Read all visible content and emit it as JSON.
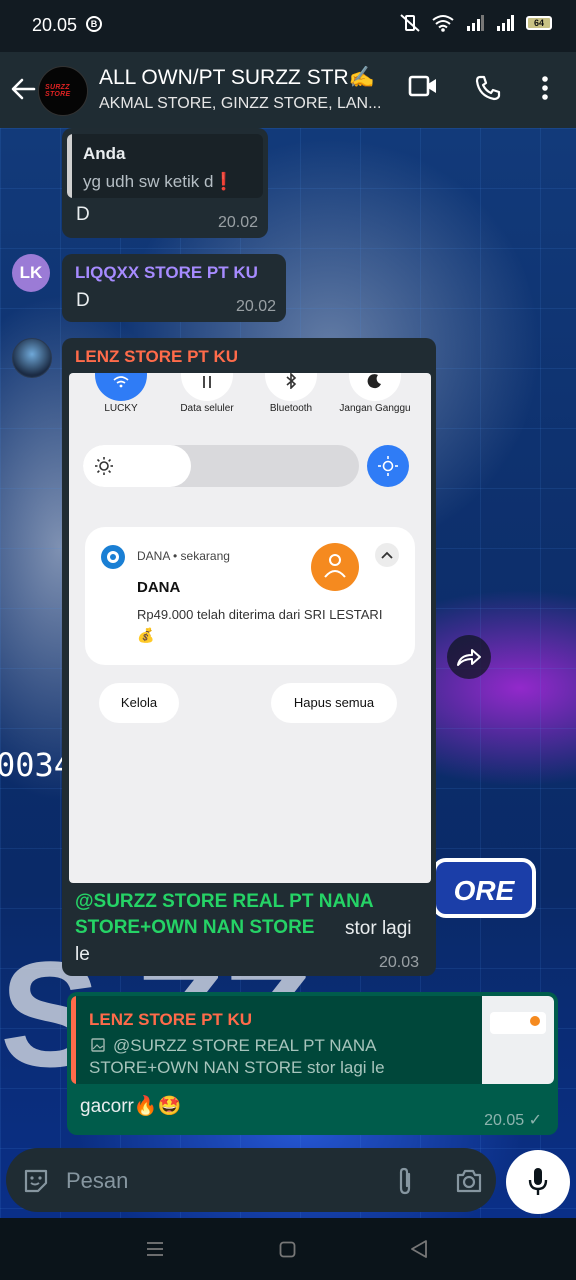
{
  "status_bar": {
    "time": "20.05",
    "battery": "64"
  },
  "header": {
    "title": "ALL OWN/PT SURZZ STR✍️",
    "subtitle": "AKMAL STORE, GINZZ STORE, LAN...",
    "avatar_text": "SURZZ STORE"
  },
  "wallpaper": {
    "watermark_number": "0034",
    "watermark_store": "ORE",
    "watermark_big": "S  ZZ"
  },
  "messages": [
    {
      "quote_sender": "Anda",
      "quote_text": "yg udh sw ketik d❗",
      "text": "D",
      "time": "20.02"
    },
    {
      "avatar_initials": "LK",
      "sender": "LIQQXX STORE PT KU",
      "text": "D",
      "time": "20.02"
    },
    {
      "sender": "LENZ STORE PT KU",
      "screenshot": {
        "tiles": [
          "LUCKY",
          "Data seluler",
          "Bluetooth",
          "Jangan Ganggu"
        ],
        "notif_app": "DANA • sekarang",
        "notif_title": "DANA",
        "notif_body": "Rp49.000 telah diterima dari SRI LESTARI",
        "notif_emoji": "💰",
        "btn_manage": "Kelola",
        "btn_clear": "Hapus semua"
      },
      "mention_line1": "@SURZZ STORE REAL PT NANA",
      "mention_line2": "STORE+OWN NAN STORE",
      "text_after_mention": "stor lagi",
      "text_line3": "le",
      "time": "20.03"
    },
    {
      "quote_sender": "LENZ STORE PT KU",
      "quote_line1": "@SURZZ STORE REAL PT NANA",
      "quote_line2": "STORE+OWN NAN STORE   stor lagi le",
      "text": "gacorr🔥🤩",
      "time": "20.05 ✓"
    }
  ],
  "input": {
    "placeholder": "Pesan"
  },
  "colors": {
    "header": "#1f2c33",
    "bubble_in": "#202c33",
    "bubble_out": "#005c4b",
    "liqqxx": "#a68bff",
    "lenz": "#ff6b4a",
    "mention": "#25d366"
  }
}
